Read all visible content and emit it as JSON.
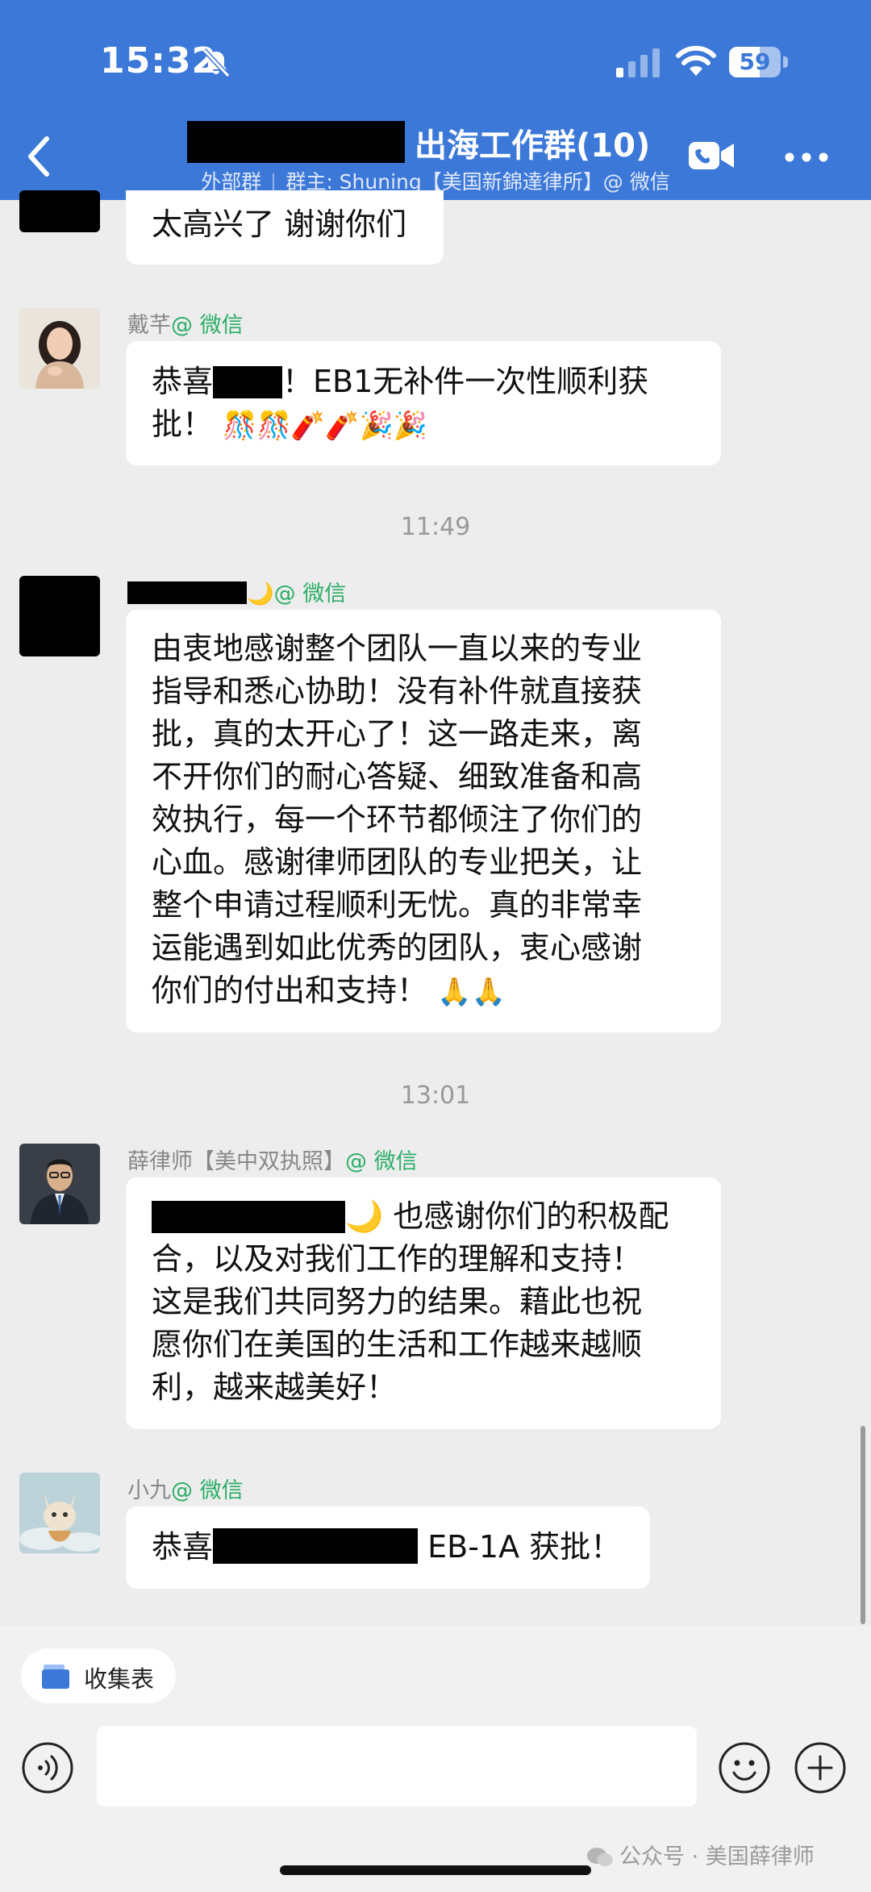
{
  "status_bar": {
    "time": "15:32",
    "battery": "59",
    "battery_level": 0.59
  },
  "header": {
    "title": "出海工作群(10)",
    "subtitle_type": "外部群",
    "subtitle_owner": "群主: Shuning【美国新錦達律所】@ 微信"
  },
  "messages": [
    {
      "text_line1": "太高兴了 谢谢你们"
    },
    {
      "sender": "戴芊",
      "sender_suffix": "@ 微信",
      "line1_prefix": "恭喜",
      "line1_suffix": "！EB1无补件一次性顺利获",
      "line2": "批！",
      "emojis": "🎊🎊🧨🧨🎉🎉"
    },
    {
      "timestamp": "11:49",
      "sender_suffix": "🌙@ 微信",
      "lines": [
        "由衷地感谢整个团队一直以来的专业",
        "指导和悉心协助！没有补件就直接获",
        "批，真的太开心了！这一路走来，离",
        "不开你们的耐心答疑、细致准备和高",
        "效执行，每一个环节都倾注了你们的",
        "心血。感谢律师团队的专业把关，让",
        "整个申请过程顺利无忧。真的非常幸",
        "运能遇到如此优秀的团队，衷心感谢"
      ],
      "last_line": "你们的付出和支持！",
      "emojis": "🙏🙏"
    },
    {
      "timestamp": "13:01",
      "sender": "薛律师【美中双执照】",
      "sender_suffix": "@ 微信",
      "line1_suffix": "🌙 也感谢你们的积极配",
      "lines": [
        "合，以及对我们工作的理解和支持！",
        "这是我们共同努力的结果。藉此也祝",
        "愿你们在美国的生活和工作越来越顺",
        "利，越来越美好！"
      ]
    },
    {
      "sender": "小九",
      "sender_suffix": "@ 微信",
      "line1_prefix": "恭喜",
      "line1_suffix": "EB-1A 获批！"
    }
  ],
  "bottom": {
    "collect_label": "收集表",
    "watermark": "公众号 · 美国薛律师"
  },
  "icons": [
    "back-icon",
    "bell-muted-icon",
    "signal-icon",
    "wifi-icon",
    "video-call-icon",
    "more-icon",
    "folder-icon",
    "voice-icon",
    "emoji-icon",
    "plus-icon"
  ],
  "colors": {
    "header_bg": "#3c78d8",
    "wechat_green": "#2aae67",
    "chat_bg": "#ededed"
  }
}
